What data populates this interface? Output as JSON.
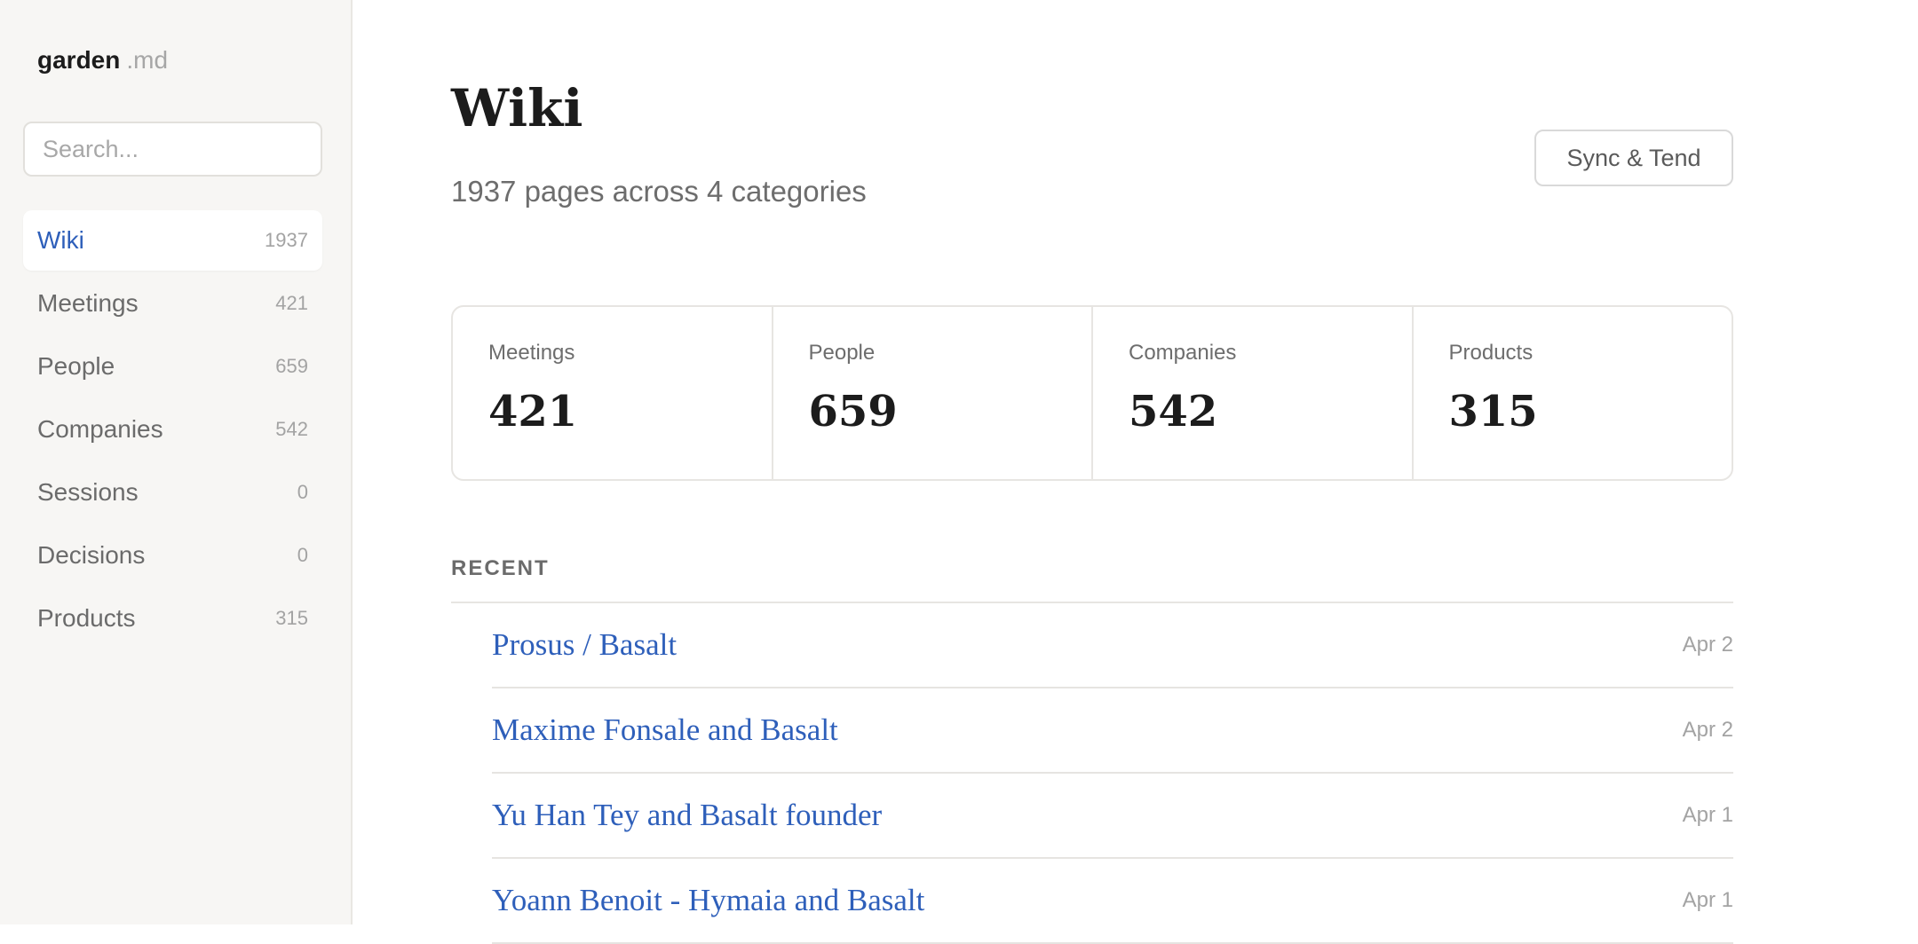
{
  "app": {
    "name": "garden",
    "name_suffix": ".md"
  },
  "sidebar": {
    "search_placeholder": "Search...",
    "items": [
      {
        "label": "Wiki",
        "count": "1937",
        "active": true
      },
      {
        "label": "Meetings",
        "count": "421"
      },
      {
        "label": "People",
        "count": "659"
      },
      {
        "label": "Companies",
        "count": "542"
      },
      {
        "label": "Sessions",
        "count": "0"
      },
      {
        "label": "Decisions",
        "count": "0"
      },
      {
        "label": "Products",
        "count": "315"
      }
    ]
  },
  "main": {
    "title": "Wiki",
    "subtitle": "1937 pages across 4 categories",
    "sync_button": "Sync & Tend",
    "stats": [
      {
        "label": "Meetings",
        "value": "421"
      },
      {
        "label": "People",
        "value": "659"
      },
      {
        "label": "Companies",
        "value": "542"
      },
      {
        "label": "Products",
        "value": "315"
      }
    ],
    "recent_heading": "RECENT",
    "recent": [
      {
        "title": "Prosus / Basalt",
        "date": "Apr 2"
      },
      {
        "title": "Maxime Fonsale and Basalt",
        "date": "Apr 2"
      },
      {
        "title": "Yu Han Tey and Basalt founder",
        "date": "Apr 1"
      },
      {
        "title": "Yoann Benoit - Hymaia and Basalt",
        "date": "Apr 1"
      }
    ]
  },
  "colors": {
    "accent": "#2e5fba",
    "sidebar_bg": "#f7f6f4",
    "muted_text": "#6d6d6d"
  }
}
